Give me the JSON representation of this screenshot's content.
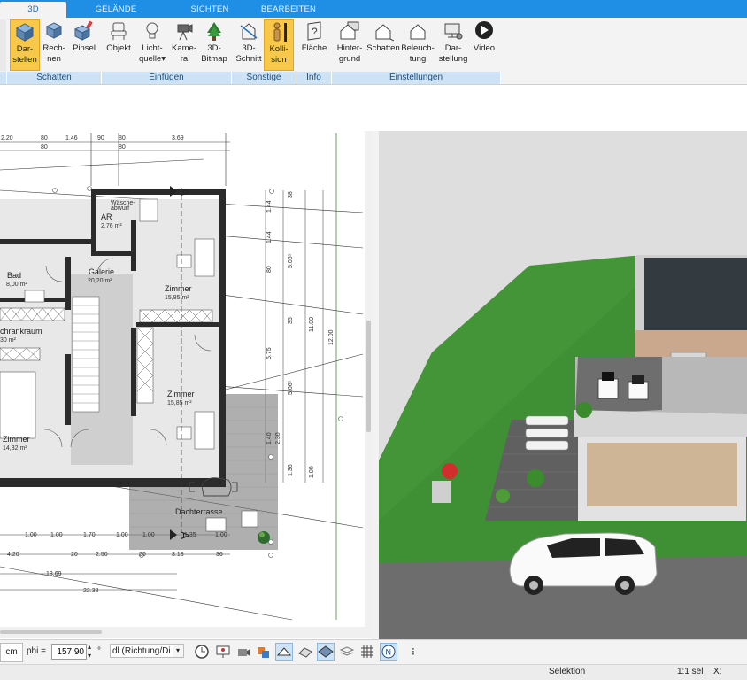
{
  "tabs": [
    {
      "label": "3D",
      "active": true
    },
    {
      "label": "GELÄNDE",
      "active": false
    },
    {
      "label": "SICHTEN",
      "active": false
    },
    {
      "label": "BEARBEITEN",
      "active": false
    }
  ],
  "ribbon": {
    "buttons": [
      {
        "l1": "Dar-",
        "l2": "stellen",
        "icon": "cube-solid-icon",
        "selected": true
      },
      {
        "l1": "Rech-",
        "l2": "nen",
        "icon": "cube-render-icon",
        "selected": false
      },
      {
        "l1": "Pinsel",
        "l2": "",
        "icon": "brush-cube-icon",
        "selected": false
      },
      {
        "l1": "Objekt",
        "l2": "",
        "icon": "chair-icon",
        "selected": false
      },
      {
        "l1": "Licht-",
        "l2": "quelle▾",
        "icon": "lightbulb-icon",
        "selected": false
      },
      {
        "l1": "Kame-",
        "l2": "ra",
        "icon": "camera-icon",
        "selected": false
      },
      {
        "l1": "3D-",
        "l2": "Bitmap",
        "icon": "tree-icon",
        "selected": false
      },
      {
        "l1": "3D-",
        "l2": "Schnitt",
        "icon": "section-icon",
        "selected": false
      },
      {
        "l1": "Kolli-",
        "l2": "sion",
        "icon": "collision-person-icon",
        "selected": true
      },
      {
        "l1": "Fläche",
        "l2": "",
        "icon": "area-info-icon",
        "selected": false
      },
      {
        "l1": "Hinter-",
        "l2": "grund",
        "icon": "house-background-icon",
        "selected": false
      },
      {
        "l1": "Schatten",
        "l2": "",
        "icon": "house-shadow-icon",
        "selected": false
      },
      {
        "l1": "Beleuch-",
        "l2": "tung",
        "icon": "house-light-icon",
        "selected": false
      },
      {
        "l1": "Dar-",
        "l2": "stellung",
        "icon": "display-settings-icon",
        "selected": false
      },
      {
        "l1": "Video",
        "l2": "",
        "icon": "video-play-icon",
        "selected": false
      }
    ],
    "groups": [
      "Schatten",
      "Einfügen",
      "Sonstige",
      "Info",
      "Einstellungen"
    ]
  },
  "plan": {
    "rooms": [
      {
        "name": "AR",
        "area": "2,76 m²"
      },
      {
        "name": "Bad",
        "area": "8,00 m²"
      },
      {
        "name": "Galerie",
        "area": "20,20 m²"
      },
      {
        "name": "Zimmer",
        "area": "15,85 m²"
      },
      {
        "name": "chrankraum",
        "area": "30 m²"
      },
      {
        "name": "Zimmer",
        "area": "15,85 m²"
      },
      {
        "name": "Zimmer",
        "area": "14,32 m²"
      },
      {
        "name": "Dachterrasse",
        "area": ""
      },
      {
        "name": "Wäsche-",
        "area": "abwurf"
      }
    ],
    "top_dims": [
      "2.20",
      "80",
      "1.46",
      "90",
      "80",
      "3.69"
    ],
    "right_dims": [
      "38",
      "1.44",
      "80",
      "5.06⁵",
      "35",
      "11.00",
      "12.00",
      "5.75",
      "5.06⁵",
      "1.40",
      "2.30",
      "1.36",
      "1.00"
    ],
    "bottom_dims": [
      "1.00",
      "1.00",
      "1.70",
      "1.00",
      "1.00",
      "1.35",
      "1.00",
      "4.20",
      "20",
      "2.50",
      "20",
      "3.13",
      "36",
      "13.69",
      "22.38"
    ],
    "section_marker": "A"
  },
  "bottom_toolbar": {
    "unit": "cm",
    "phi_label": "phi =",
    "phi_value": "157,90",
    "degree": "°",
    "mode": "dl (Richtung/Di"
  },
  "status": {
    "mode": "Selektion",
    "scale": "1:1 sel",
    "x_label": "X:"
  }
}
